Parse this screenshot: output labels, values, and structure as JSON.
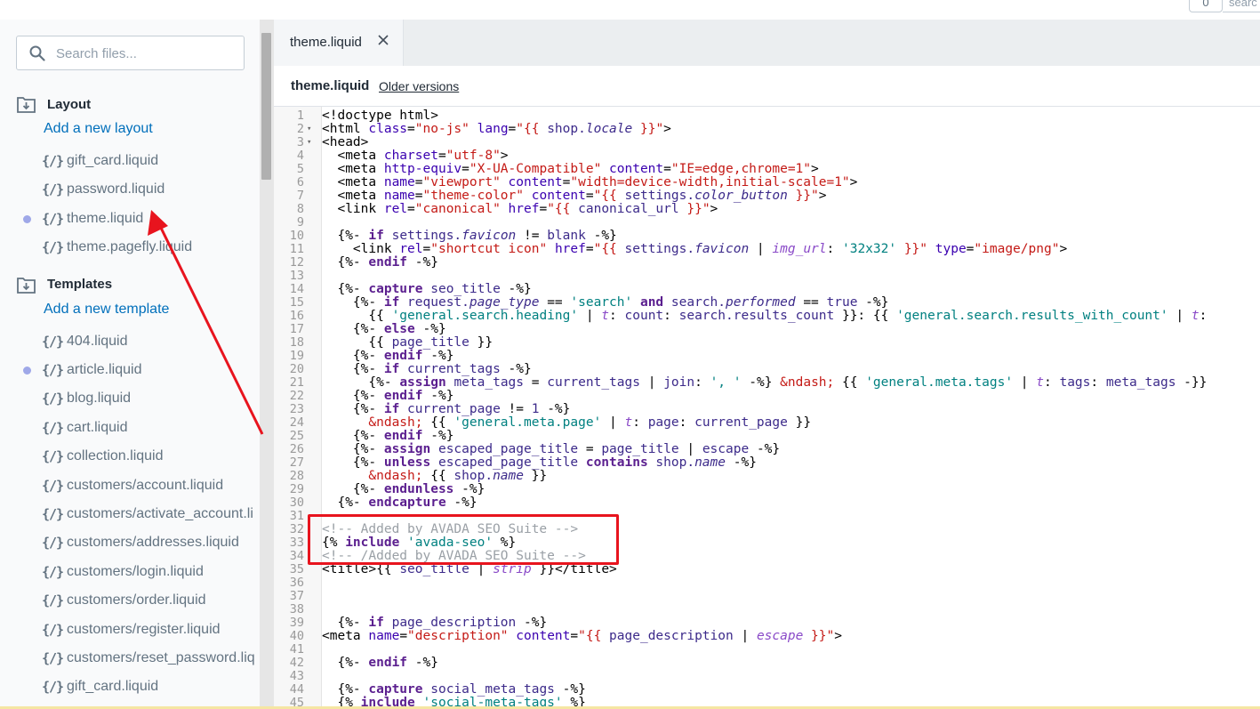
{
  "topbar": {
    "counter": "0",
    "search_fragment": "searc"
  },
  "search": {
    "placeholder": "Search files..."
  },
  "sections": [
    {
      "title": "Layout",
      "add_label": "Add a new layout",
      "files": [
        {
          "name": "gift_card.liquid",
          "dot": false
        },
        {
          "name": "password.liquid",
          "dot": false
        },
        {
          "name": "theme.liquid",
          "dot": true
        },
        {
          "name": "theme.pagefly.liquid",
          "dot": false
        }
      ]
    },
    {
      "title": "Templates",
      "add_label": "Add a new template",
      "files": [
        {
          "name": "404.liquid",
          "dot": false
        },
        {
          "name": "article.liquid",
          "dot": true
        },
        {
          "name": "blog.liquid",
          "dot": false
        },
        {
          "name": "cart.liquid",
          "dot": false
        },
        {
          "name": "collection.liquid",
          "dot": false
        },
        {
          "name": "customers/account.liquid",
          "dot": false
        },
        {
          "name": "customers/activate_account.li",
          "dot": false
        },
        {
          "name": "customers/addresses.liquid",
          "dot": false
        },
        {
          "name": "customers/login.liquid",
          "dot": false
        },
        {
          "name": "customers/order.liquid",
          "dot": false
        },
        {
          "name": "customers/register.liquid",
          "dot": false
        },
        {
          "name": "customers/reset_password.liq",
          "dot": false
        },
        {
          "name": "gift_card.liquid",
          "dot": false
        }
      ]
    }
  ],
  "file_icon_glyph": "{/}",
  "editor": {
    "tab_label": "theme.liquid",
    "file_name": "theme.liquid",
    "older_versions": "Older versions"
  },
  "colors": {
    "tag": "#000000",
    "attr": "#3a00b0",
    "str": "#c41a16",
    "str2": "#008080",
    "kw": "#5b1f8f",
    "var": "#3c2a8a",
    "prop": "#3c2a8a",
    "filter": "#8a4ac8",
    "comment": "#9aa0a6",
    "annotation_red": "#e8141e",
    "link": "#006fbb"
  },
  "code_lines": [
    {
      "n": 1,
      "fold": false,
      "t": [
        [
          "tag",
          "<!doctype html>"
        ]
      ]
    },
    {
      "n": 2,
      "fold": true,
      "t": [
        [
          "tag",
          "<html "
        ],
        [
          "attr",
          "class"
        ],
        [
          "tag",
          "="
        ],
        [
          "str",
          "\"no-js\""
        ],
        [
          "tag",
          " "
        ],
        [
          "attr",
          "lang"
        ],
        [
          "tag",
          "="
        ],
        [
          "str",
          "\"{{ "
        ],
        [
          "var",
          "shop."
        ],
        [
          "propi",
          "locale"
        ],
        [
          "str",
          " }}\""
        ],
        [
          "tag",
          ">"
        ]
      ]
    },
    {
      "n": 3,
      "fold": true,
      "t": [
        [
          "tag",
          "<head>"
        ]
      ]
    },
    {
      "n": 4,
      "fold": false,
      "t": [
        [
          "tag",
          "  <meta "
        ],
        [
          "attr",
          "charset"
        ],
        [
          "tag",
          "="
        ],
        [
          "str",
          "\"utf-8\""
        ],
        [
          "tag",
          ">"
        ]
      ]
    },
    {
      "n": 5,
      "fold": false,
      "t": [
        [
          "tag",
          "  <meta "
        ],
        [
          "attr",
          "http-equiv"
        ],
        [
          "tag",
          "="
        ],
        [
          "str",
          "\"X-UA-Compatible\""
        ],
        [
          "tag",
          " "
        ],
        [
          "attr",
          "content"
        ],
        [
          "tag",
          "="
        ],
        [
          "str",
          "\"IE=edge,chrome=1\""
        ],
        [
          "tag",
          ">"
        ]
      ]
    },
    {
      "n": 6,
      "fold": false,
      "t": [
        [
          "tag",
          "  <meta "
        ],
        [
          "attr",
          "name"
        ],
        [
          "tag",
          "="
        ],
        [
          "str",
          "\"viewport\""
        ],
        [
          "tag",
          " "
        ],
        [
          "attr",
          "content"
        ],
        [
          "tag",
          "="
        ],
        [
          "str",
          "\"width=device-width,initial-scale=1\""
        ],
        [
          "tag",
          ">"
        ]
      ]
    },
    {
      "n": 7,
      "fold": false,
      "t": [
        [
          "tag",
          "  <meta "
        ],
        [
          "attr",
          "name"
        ],
        [
          "tag",
          "="
        ],
        [
          "str",
          "\"theme-color\""
        ],
        [
          "tag",
          " "
        ],
        [
          "attr",
          "content"
        ],
        [
          "tag",
          "="
        ],
        [
          "str",
          "\"{{ "
        ],
        [
          "var",
          "settings."
        ],
        [
          "propi",
          "color_button"
        ],
        [
          "str",
          " }}\""
        ],
        [
          "tag",
          ">"
        ]
      ]
    },
    {
      "n": 8,
      "fold": false,
      "t": [
        [
          "tag",
          "  <link "
        ],
        [
          "attr",
          "rel"
        ],
        [
          "tag",
          "="
        ],
        [
          "str",
          "\"canonical\""
        ],
        [
          "tag",
          " "
        ],
        [
          "attr",
          "href"
        ],
        [
          "tag",
          "="
        ],
        [
          "str",
          "\"{{ "
        ],
        [
          "var",
          "canonical_url"
        ],
        [
          "str",
          " }}\""
        ],
        [
          "tag",
          ">"
        ]
      ]
    },
    {
      "n": 9,
      "fold": false,
      "t": []
    },
    {
      "n": 10,
      "fold": false,
      "t": [
        [
          "tag",
          "  {%- "
        ],
        [
          "kw",
          "if"
        ],
        [
          "tag",
          " "
        ],
        [
          "var",
          "settings."
        ],
        [
          "propi",
          "favicon"
        ],
        [
          "tag",
          " != "
        ],
        [
          "var",
          "blank"
        ],
        [
          "tag",
          " -%}"
        ]
      ]
    },
    {
      "n": 11,
      "fold": false,
      "t": [
        [
          "tag",
          "    <link "
        ],
        [
          "attr",
          "rel"
        ],
        [
          "tag",
          "="
        ],
        [
          "str",
          "\"shortcut icon\""
        ],
        [
          "tag",
          " "
        ],
        [
          "attr",
          "href"
        ],
        [
          "tag",
          "="
        ],
        [
          "str",
          "\"{{ "
        ],
        [
          "var",
          "settings."
        ],
        [
          "propi",
          "favicon"
        ],
        [
          "tag",
          " | "
        ],
        [
          "filter",
          "img_url"
        ],
        [
          "tag",
          ": "
        ],
        [
          "str2",
          "'32x32'"
        ],
        [
          "str",
          " }}\""
        ],
        [
          "tag",
          " "
        ],
        [
          "attr",
          "type"
        ],
        [
          "tag",
          "="
        ],
        [
          "str",
          "\"image/png\""
        ],
        [
          "tag",
          ">"
        ]
      ]
    },
    {
      "n": 12,
      "fold": false,
      "t": [
        [
          "tag",
          "  {%- "
        ],
        [
          "kw",
          "endif"
        ],
        [
          "tag",
          " -%}"
        ]
      ]
    },
    {
      "n": 13,
      "fold": false,
      "t": []
    },
    {
      "n": 14,
      "fold": false,
      "t": [
        [
          "tag",
          "  {%- "
        ],
        [
          "kw",
          "capture"
        ],
        [
          "tag",
          " "
        ],
        [
          "var",
          "seo_title"
        ],
        [
          "tag",
          " -%}"
        ]
      ]
    },
    {
      "n": 15,
      "fold": false,
      "t": [
        [
          "tag",
          "    {%- "
        ],
        [
          "kw",
          "if"
        ],
        [
          "tag",
          " "
        ],
        [
          "var",
          "request."
        ],
        [
          "propi",
          "page_type"
        ],
        [
          "tag",
          " == "
        ],
        [
          "str2",
          "'search'"
        ],
        [
          "tag",
          " "
        ],
        [
          "kw",
          "and"
        ],
        [
          "tag",
          " "
        ],
        [
          "var",
          "search."
        ],
        [
          "propi",
          "performed"
        ],
        [
          "tag",
          " == "
        ],
        [
          "var",
          "true"
        ],
        [
          "tag",
          " -%}"
        ]
      ]
    },
    {
      "n": 16,
      "fold": false,
      "t": [
        [
          "tag",
          "      {{ "
        ],
        [
          "str2",
          "'general.search.heading'"
        ],
        [
          "tag",
          " | "
        ],
        [
          "filter",
          "t"
        ],
        [
          "tag",
          ": "
        ],
        [
          "var",
          "count"
        ],
        [
          "tag",
          ": "
        ],
        [
          "var",
          "search.results_count"
        ],
        [
          "tag",
          " }}: {{ "
        ],
        [
          "str2",
          "'general.search.results_with_count'"
        ],
        [
          "tag",
          " | "
        ],
        [
          "filter",
          "t"
        ],
        [
          "tag",
          ":"
        ]
      ]
    },
    {
      "n": 17,
      "fold": false,
      "t": [
        [
          "tag",
          "    {%- "
        ],
        [
          "kw",
          "else"
        ],
        [
          "tag",
          " -%}"
        ]
      ]
    },
    {
      "n": 18,
      "fold": false,
      "t": [
        [
          "tag",
          "      {{ "
        ],
        [
          "var",
          "page_title"
        ],
        [
          "tag",
          " }}"
        ]
      ]
    },
    {
      "n": 19,
      "fold": false,
      "t": [
        [
          "tag",
          "    {%- "
        ],
        [
          "kw",
          "endif"
        ],
        [
          "tag",
          " -%}"
        ]
      ]
    },
    {
      "n": 20,
      "fold": false,
      "t": [
        [
          "tag",
          "    {%- "
        ],
        [
          "kw",
          "if"
        ],
        [
          "tag",
          " "
        ],
        [
          "var",
          "current_tags"
        ],
        [
          "tag",
          " -%}"
        ]
      ]
    },
    {
      "n": 21,
      "fold": false,
      "t": [
        [
          "tag",
          "      {%- "
        ],
        [
          "kw",
          "assign"
        ],
        [
          "tag",
          " "
        ],
        [
          "var",
          "meta_tags"
        ],
        [
          "tag",
          " = "
        ],
        [
          "var",
          "current_tags"
        ],
        [
          "tag",
          " | "
        ],
        [
          "var",
          "join"
        ],
        [
          "tag",
          ": "
        ],
        [
          "str2",
          "', '"
        ],
        [
          "tag",
          " -%} "
        ],
        [
          "str",
          "&ndash;"
        ],
        [
          "tag",
          " {{ "
        ],
        [
          "str2",
          "'general.meta.tags'"
        ],
        [
          "tag",
          " | "
        ],
        [
          "filter",
          "t"
        ],
        [
          "tag",
          ": "
        ],
        [
          "var",
          "tags"
        ],
        [
          "tag",
          ": "
        ],
        [
          "var",
          "meta_tags"
        ],
        [
          "tag",
          " -}}"
        ]
      ]
    },
    {
      "n": 22,
      "fold": false,
      "t": [
        [
          "tag",
          "    {%- "
        ],
        [
          "kw",
          "endif"
        ],
        [
          "tag",
          " -%}"
        ]
      ]
    },
    {
      "n": 23,
      "fold": false,
      "t": [
        [
          "tag",
          "    {%- "
        ],
        [
          "kw",
          "if"
        ],
        [
          "tag",
          " "
        ],
        [
          "var",
          "current_page"
        ],
        [
          "tag",
          " != "
        ],
        [
          "var",
          "1"
        ],
        [
          "tag",
          " -%}"
        ]
      ]
    },
    {
      "n": 24,
      "fold": false,
      "t": [
        [
          "str",
          "      &ndash;"
        ],
        [
          "tag",
          " {{ "
        ],
        [
          "str2",
          "'general.meta.page'"
        ],
        [
          "tag",
          " | "
        ],
        [
          "filter",
          "t"
        ],
        [
          "tag",
          ": "
        ],
        [
          "var",
          "page"
        ],
        [
          "tag",
          ": "
        ],
        [
          "var",
          "current_page"
        ],
        [
          "tag",
          " }}"
        ]
      ]
    },
    {
      "n": 25,
      "fold": false,
      "t": [
        [
          "tag",
          "    {%- "
        ],
        [
          "kw",
          "endif"
        ],
        [
          "tag",
          " -%}"
        ]
      ]
    },
    {
      "n": 26,
      "fold": false,
      "t": [
        [
          "tag",
          "    {%- "
        ],
        [
          "kw",
          "assign"
        ],
        [
          "tag",
          " "
        ],
        [
          "var",
          "escaped_page_title"
        ],
        [
          "tag",
          " = "
        ],
        [
          "var",
          "page_title"
        ],
        [
          "tag",
          " | "
        ],
        [
          "var",
          "escape"
        ],
        [
          "tag",
          " -%}"
        ]
      ]
    },
    {
      "n": 27,
      "fold": false,
      "t": [
        [
          "tag",
          "    {%- "
        ],
        [
          "kw",
          "unless"
        ],
        [
          "tag",
          " "
        ],
        [
          "var",
          "escaped_page_title"
        ],
        [
          "tag",
          " "
        ],
        [
          "kw",
          "contains"
        ],
        [
          "tag",
          " "
        ],
        [
          "var",
          "shop."
        ],
        [
          "propi",
          "name"
        ],
        [
          "tag",
          " -%}"
        ]
      ]
    },
    {
      "n": 28,
      "fold": false,
      "t": [
        [
          "str",
          "      &ndash;"
        ],
        [
          "tag",
          " {{ "
        ],
        [
          "var",
          "shop."
        ],
        [
          "propi",
          "name"
        ],
        [
          "tag",
          " }}"
        ]
      ]
    },
    {
      "n": 29,
      "fold": false,
      "t": [
        [
          "tag",
          "    {%- "
        ],
        [
          "kw",
          "endunless"
        ],
        [
          "tag",
          " -%}"
        ]
      ]
    },
    {
      "n": 30,
      "fold": false,
      "t": [
        [
          "tag",
          "  {%- "
        ],
        [
          "kw",
          "endcapture"
        ],
        [
          "tag",
          " -%}"
        ]
      ]
    },
    {
      "n": 31,
      "fold": false,
      "t": []
    },
    {
      "n": 32,
      "fold": false,
      "t": [
        [
          "comment",
          "<!-- Added by AVADA SEO Suite -->"
        ]
      ]
    },
    {
      "n": 33,
      "fold": false,
      "t": [
        [
          "tag",
          "{% "
        ],
        [
          "kw",
          "include"
        ],
        [
          "tag",
          " "
        ],
        [
          "str2",
          "'avada-seo'"
        ],
        [
          "tag",
          " %}"
        ]
      ]
    },
    {
      "n": 34,
      "fold": false,
      "t": [
        [
          "comment",
          "<!-- /Added by AVADA SEO Suite -->"
        ]
      ]
    },
    {
      "n": 35,
      "fold": false,
      "t": [
        [
          "tag",
          "<title>{{ "
        ],
        [
          "var",
          "seo_title"
        ],
        [
          "tag",
          " | "
        ],
        [
          "filter",
          "strip"
        ],
        [
          "tag",
          " }}</title>"
        ]
      ]
    },
    {
      "n": 36,
      "fold": false,
      "t": []
    },
    {
      "n": 37,
      "fold": false,
      "t": []
    },
    {
      "n": 38,
      "fold": false,
      "t": []
    },
    {
      "n": 39,
      "fold": false,
      "t": [
        [
          "tag",
          "  {%- "
        ],
        [
          "kw",
          "if"
        ],
        [
          "tag",
          " "
        ],
        [
          "var",
          "page_description"
        ],
        [
          "tag",
          " -%}"
        ]
      ]
    },
    {
      "n": 40,
      "fold": false,
      "t": [
        [
          "tag",
          "<meta "
        ],
        [
          "attr",
          "name"
        ],
        [
          "tag",
          "="
        ],
        [
          "str",
          "\"description\""
        ],
        [
          "tag",
          " "
        ],
        [
          "attr",
          "content"
        ],
        [
          "tag",
          "="
        ],
        [
          "str",
          "\"{{ "
        ],
        [
          "var",
          "page_description"
        ],
        [
          "tag",
          " | "
        ],
        [
          "filter",
          "escape"
        ],
        [
          "str",
          " }}\""
        ],
        [
          "tag",
          ">"
        ]
      ]
    },
    {
      "n": 41,
      "fold": false,
      "t": []
    },
    {
      "n": 42,
      "fold": false,
      "t": [
        [
          "tag",
          "  {%- "
        ],
        [
          "kw",
          "endif"
        ],
        [
          "tag",
          " -%}"
        ]
      ]
    },
    {
      "n": 43,
      "fold": false,
      "t": []
    },
    {
      "n": 44,
      "fold": false,
      "t": [
        [
          "tag",
          "  {%- "
        ],
        [
          "kw",
          "capture"
        ],
        [
          "tag",
          " "
        ],
        [
          "var",
          "social_meta_tags"
        ],
        [
          "tag",
          " -%}"
        ]
      ]
    },
    {
      "n": 45,
      "fold": false,
      "t": [
        [
          "tag",
          "  {% "
        ],
        [
          "kw",
          "include"
        ],
        [
          "tag",
          " "
        ],
        [
          "str2",
          "'social-meta-tags'"
        ],
        [
          "tag",
          " %}"
        ]
      ]
    }
  ]
}
